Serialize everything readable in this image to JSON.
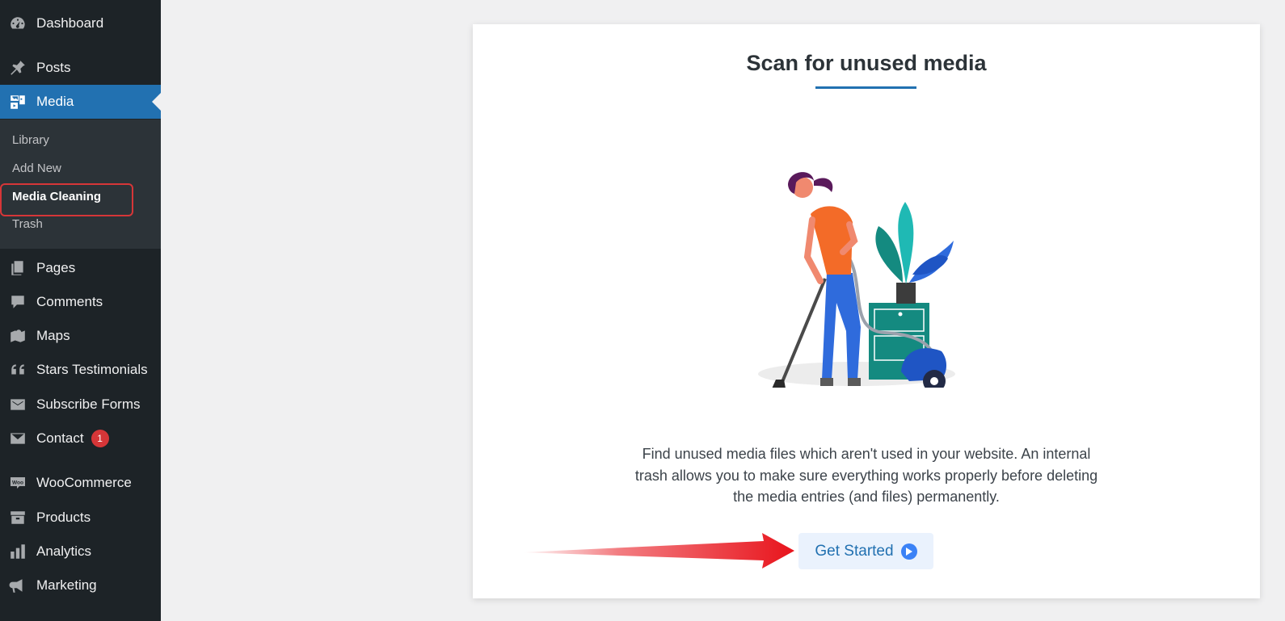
{
  "sidebar": {
    "items": [
      {
        "label": "Dashboard",
        "icon": "dashboard-icon"
      },
      {
        "label": "Posts",
        "icon": "pin-icon"
      },
      {
        "label": "Media",
        "icon": "media-icon",
        "active": true
      },
      {
        "label": "Pages",
        "icon": "pages-icon"
      },
      {
        "label": "Comments",
        "icon": "comment-icon"
      },
      {
        "label": "Maps",
        "icon": "map-icon"
      },
      {
        "label": "Stars Testimonials",
        "icon": "quote-icon"
      },
      {
        "label": "Subscribe Forms",
        "icon": "mail-icon"
      },
      {
        "label": "Contact",
        "icon": "envelope-icon",
        "badge": "1"
      },
      {
        "label": "WooCommerce",
        "icon": "woo-icon"
      },
      {
        "label": "Products",
        "icon": "archive-icon"
      },
      {
        "label": "Analytics",
        "icon": "bar-chart-icon"
      },
      {
        "label": "Marketing",
        "icon": "megaphone-icon"
      }
    ],
    "media_submenu": [
      "Library",
      "Add New",
      "Media Cleaning",
      "Trash"
    ]
  },
  "main": {
    "title": "Scan for unused media",
    "description": "Find unused media files which aren't used in your website. An internal trash allows you to make sure everything works properly before deleting the media entries (and files) permanently.",
    "button_label": "Get Started"
  },
  "colors": {
    "sidebar_bg": "#1d2327",
    "submenu_bg": "#2c3338",
    "accent": "#2271b1",
    "highlight": "#d63638",
    "arrow": "#e8141c"
  }
}
